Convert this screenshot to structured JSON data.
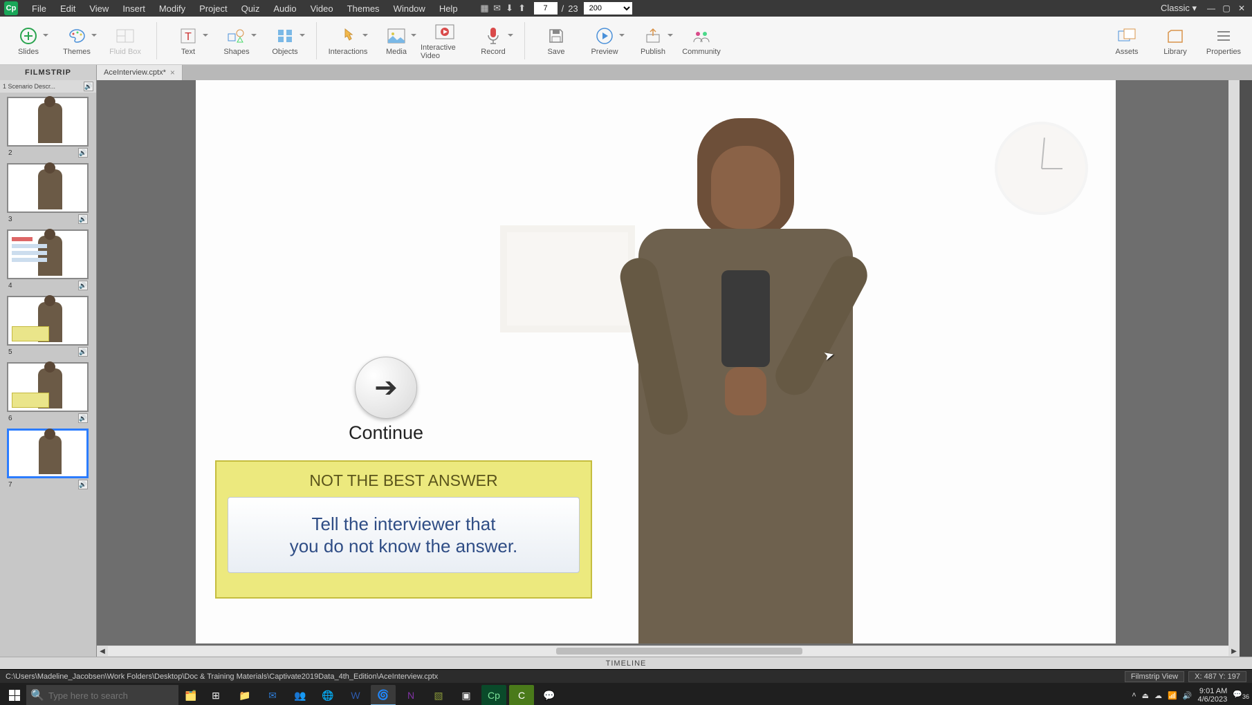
{
  "menubar": {
    "items": [
      "File",
      "Edit",
      "View",
      "Insert",
      "Modify",
      "Project",
      "Quiz",
      "Audio",
      "Video",
      "Themes",
      "Window",
      "Help"
    ],
    "slide_current": "7",
    "slide_sep": "/",
    "slide_total": "23",
    "zoom": "200",
    "workspace": "Classic"
  },
  "toolbar": {
    "groups": [
      [
        "Slides",
        "Themes",
        "Fluid Box"
      ],
      [
        "Text",
        "Shapes",
        "Objects"
      ],
      [
        "Interactions",
        "Media",
        "Interactive Video",
        "Record"
      ],
      [
        "Save",
        "Preview",
        "Publish",
        "Community"
      ]
    ],
    "right": [
      "Assets",
      "Library",
      "Properties"
    ]
  },
  "tabs": {
    "filmstrip": "FILMSTRIP",
    "file": "AceInterview.cptx*",
    "close": "×"
  },
  "filmstrip": {
    "toprow": "1 Scenario Descr...",
    "speaker": "🔊",
    "thumbs": [
      {
        "num": "2",
        "type": "person"
      },
      {
        "num": "3",
        "type": "person"
      },
      {
        "num": "4",
        "type": "lines-person"
      },
      {
        "num": "5",
        "type": "caption-person"
      },
      {
        "num": "6",
        "type": "caption-person"
      },
      {
        "num": "7",
        "type": "person",
        "selected": true
      }
    ]
  },
  "slide": {
    "continue_label": "Continue",
    "box_title": "NOT THE BEST ANSWER",
    "box_text_line1": "Tell the interviewer that",
    "box_text_line2": "you do not know the answer."
  },
  "timeline": "TIMELINE",
  "status": {
    "path": "C:\\Users\\Madeline_Jacobsen\\Work Folders\\Desktop\\Doc & Training Materials\\Captivate2019Data_4th_Edition\\AceInterview.cptx",
    "view": "Filmstrip View",
    "coords": "X: 487 Y: 197"
  },
  "taskbar": {
    "search_placeholder": "Type here to search",
    "time": "9:01 AM",
    "date": "4/6/2023",
    "notif": "36"
  }
}
